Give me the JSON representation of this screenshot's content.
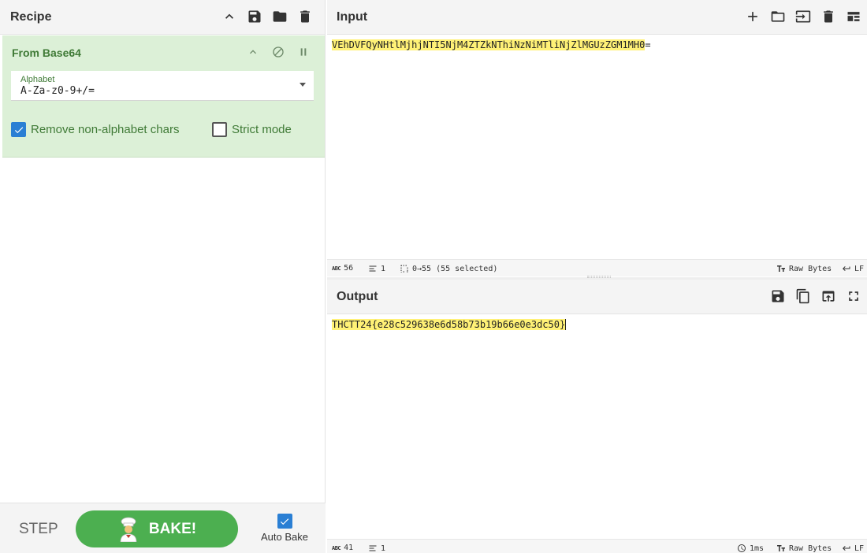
{
  "recipe": {
    "title": "Recipe",
    "header_icons": [
      "chevron-up-icon",
      "save-icon",
      "folder-icon",
      "trash-icon"
    ],
    "operation": {
      "name": "From Base64",
      "alphabet_label": "Alphabet",
      "alphabet_value": "A-Za-z0-9+/=",
      "remove_non_alphabet_label": "Remove non-alphabet chars",
      "remove_non_alphabet_checked": true,
      "strict_mode_label": "Strict mode",
      "strict_mode_checked": false
    },
    "step_label": "STEP",
    "bake_label": "BAKE!",
    "auto_bake_label": "Auto Bake",
    "auto_bake_checked": true
  },
  "input": {
    "title": "Input",
    "text_highlighted": "VEhDVFQyNHtlMjhjNTI5NjM4ZTZkNThiNzNiMTliNjZlMGUzZGM1MH0",
    "text_rest": "=",
    "status": {
      "length": "56",
      "lines": "1",
      "selection": "0→55 (55 selected)",
      "raw_bytes": "Raw Bytes",
      "eol": "LF"
    }
  },
  "output": {
    "title": "Output",
    "text_highlighted": "THCTT24{e28c529638e6d58b73b19b66e0e3dc50}",
    "status": {
      "length": "41",
      "lines": "1",
      "time": "1ms",
      "raw_bytes": "Raw Bytes",
      "eol": "LF"
    }
  },
  "colors": {
    "operation_bg": "#dcf0d7",
    "operation_text": "#3f7a36",
    "bake_button": "#4caf50",
    "highlight": "#fff176",
    "checkbox": "#2a7fd4"
  }
}
